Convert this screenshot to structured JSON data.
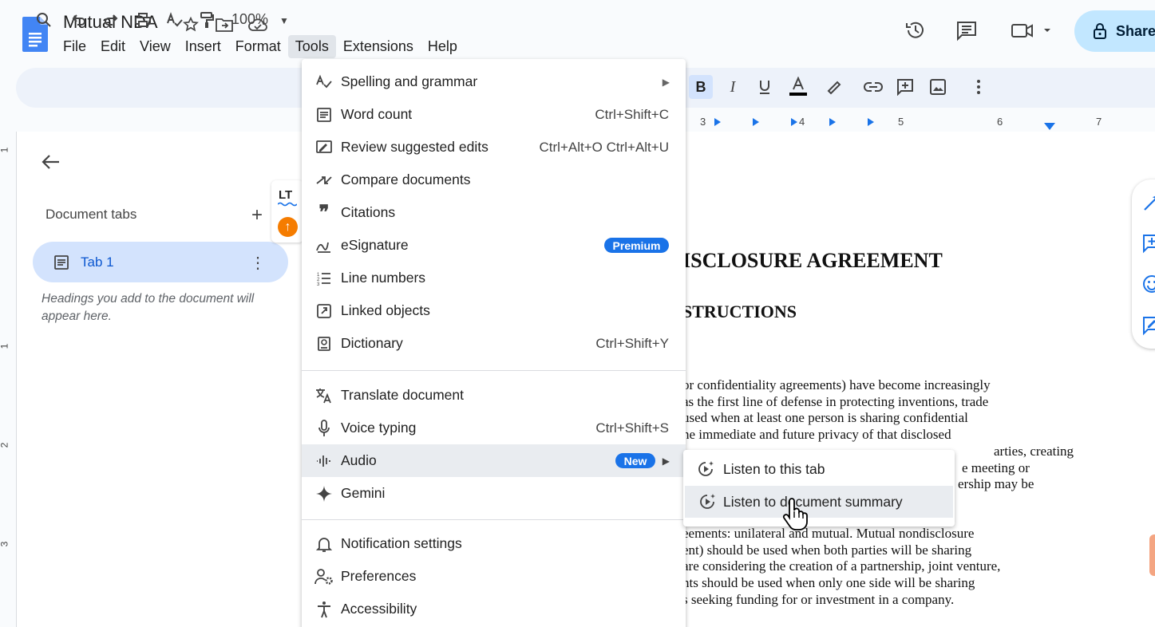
{
  "app": {
    "title": "Mutual NDA",
    "share_label": "Share",
    "menu": [
      "File",
      "Edit",
      "View",
      "Insert",
      "Format",
      "Tools",
      "Extensions",
      "Help"
    ],
    "active_menu": "Tools"
  },
  "toolbar": {
    "zoom": "100%",
    "ruler_numbers": [
      "3",
      "4",
      "5",
      "6",
      "7"
    ],
    "vruler_numbers": [
      "1",
      "1",
      "2",
      "3"
    ]
  },
  "side_panel": {
    "heading": "Document tabs",
    "add_icon": "+",
    "tab_label": "Tab 1",
    "hint": "Headings you add to the document will appear here."
  },
  "extension": {
    "logo": "LT",
    "badge_icon": "arrow-up-icon"
  },
  "tools_menu": {
    "items": [
      {
        "label": "Spelling and grammar",
        "icon": "spellcheck-icon",
        "submenu": true
      },
      {
        "label": "Word count",
        "icon": "word-count-icon",
        "shortcut": "Ctrl+Shift+C"
      },
      {
        "label": "Review suggested edits",
        "icon": "review-edits-icon",
        "shortcut": "Ctrl+Alt+O Ctrl+Alt+U"
      },
      {
        "label": "Compare documents",
        "icon": "compare-icon"
      },
      {
        "label": "Citations",
        "icon": "quote-icon"
      },
      {
        "label": "eSignature",
        "icon": "signature-icon",
        "badge": "Premium"
      },
      {
        "label": "Line numbers",
        "icon": "line-numbers-icon"
      },
      {
        "label": "Linked objects",
        "icon": "linked-objects-icon"
      },
      {
        "label": "Dictionary",
        "icon": "dictionary-icon",
        "shortcut": "Ctrl+Shift+Y"
      },
      {
        "label": "Translate document",
        "icon": "translate-icon"
      },
      {
        "label": "Voice typing",
        "icon": "mic-icon",
        "shortcut": "Ctrl+Shift+S"
      },
      {
        "label": "Audio",
        "icon": "audio-icon",
        "badge": "New",
        "submenu": true
      },
      {
        "label": "Gemini",
        "icon": "gemini-icon"
      },
      {
        "label": "Notification settings",
        "icon": "bell-icon"
      },
      {
        "label": "Preferences",
        "icon": "preferences-icon"
      },
      {
        "label": "Accessibility",
        "icon": "accessibility-icon"
      }
    ]
  },
  "audio_submenu": {
    "items": [
      {
        "label": "Listen to this tab",
        "icon": "play-sparkle-icon"
      },
      {
        "label": "Listen to document summary",
        "icon": "play-sparkle-icon"
      }
    ]
  },
  "document": {
    "heading1": "ISCLOSURE AGREEMENT",
    "heading2": "STRUCTIONS",
    "paragraph1": [
      "or confidentiality agreements) have become increasingly",
      "as the first line of defense in protecting inventions, trade",
      "used when at least one person is sharing confidential",
      "he immediate and future privacy of that disclosed",
      "arties, creating",
      "e meeting or",
      "ership may be"
    ],
    "paragraph2": [
      "eements: unilateral and mutual. Mutual nondisclosure",
      "ent) should be used when both parties will be sharing",
      "are considering the creation of a partnership, joint venture,",
      "nts should be used when only one side will be sharing",
      "s seeking funding for or investment in a company."
    ]
  },
  "colors": {
    "accent": "#1a73e8",
    "share_bg": "#c2e7ff",
    "tab_bg": "#d3e3fd",
    "menu_hover": "#e9ecf0"
  }
}
